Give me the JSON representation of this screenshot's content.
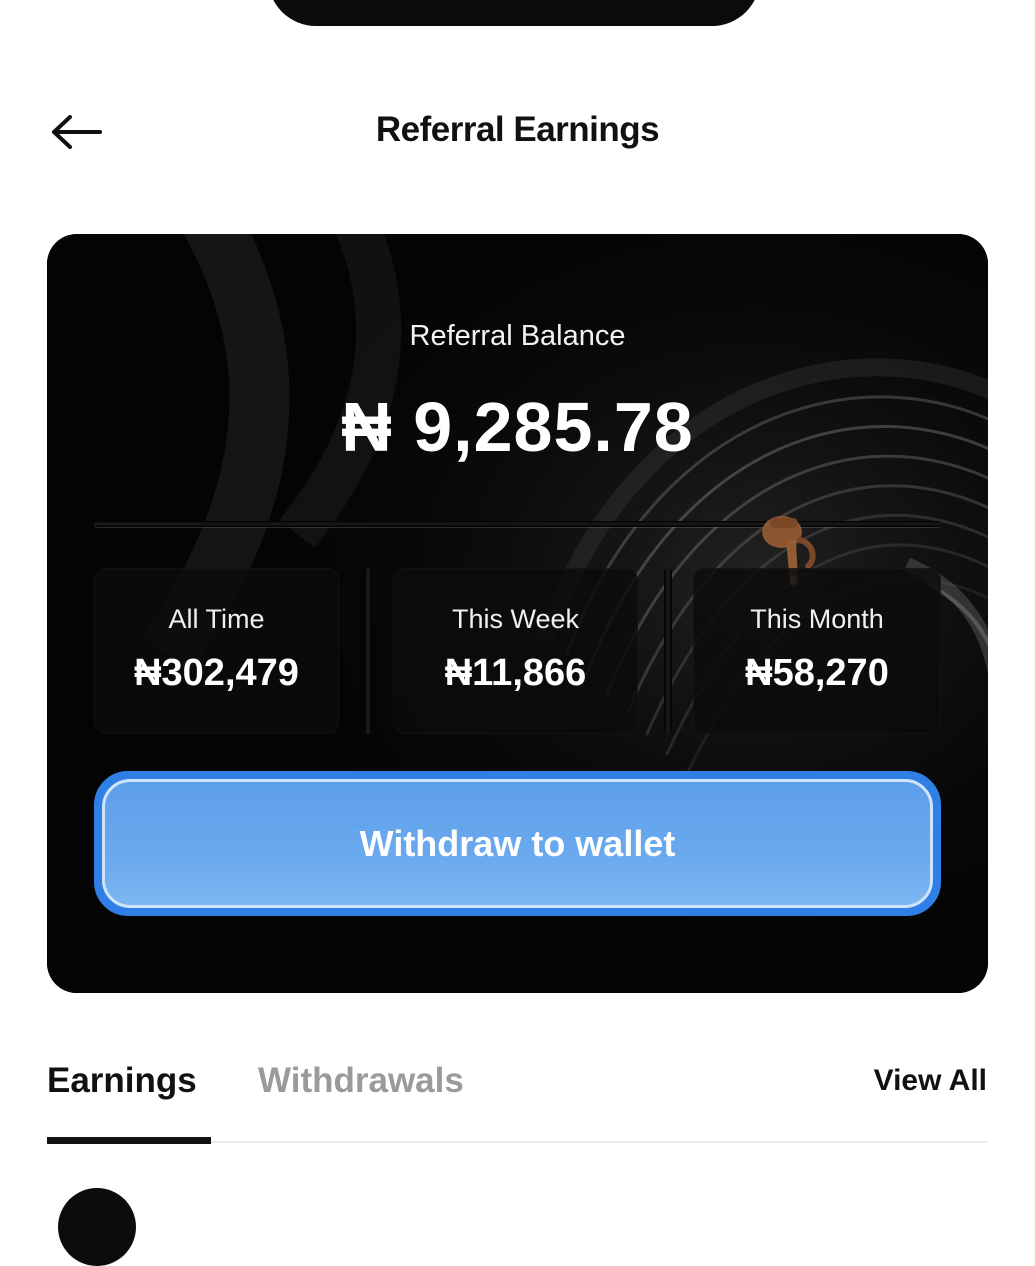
{
  "header": {
    "title": "Referral Earnings",
    "back_icon": "arrow-left-icon"
  },
  "card": {
    "balance_label": "Referral Balance",
    "balance_value": "₦ 9,285.78",
    "pointer_icon": "backhand-index-pointing-down-icon",
    "stats": [
      {
        "label": "All Time",
        "value": "₦302,479"
      },
      {
        "label": "This Week",
        "value": "₦11,866"
      },
      {
        "label": "This Month",
        "value": "₦58,270"
      }
    ],
    "withdraw_label": "Withdraw to wallet",
    "colors": {
      "button_accent": "#2f7fe6",
      "button_fill": "#6aa9ee",
      "card_background": "#050505"
    }
  },
  "tabs": {
    "items": [
      {
        "label": "Earnings",
        "active": true
      },
      {
        "label": "Withdrawals",
        "active": false
      }
    ],
    "view_all_label": "View All"
  }
}
